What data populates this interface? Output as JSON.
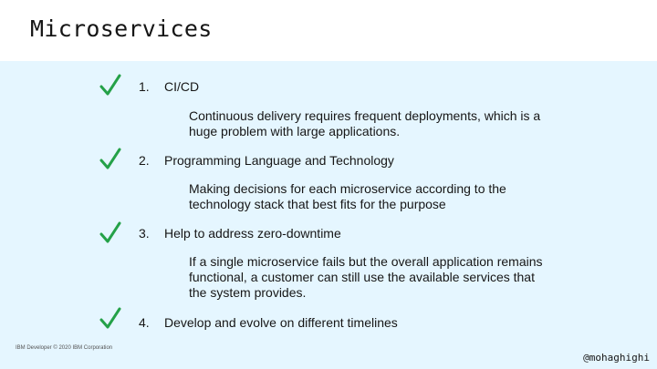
{
  "slide": {
    "title": "Microservices",
    "footer_left": "IBM Developer © 2020 IBM Corporation",
    "footer_right": "@mohaghighi",
    "accent_color": "#24a148",
    "background_color": "#e5f6ff"
  },
  "items": [
    {
      "icon": "checkmark-icon",
      "number": "1.",
      "label": "CI/CD",
      "description": "Continuous delivery requires frequent deployments, which is a huge problem with large applications."
    },
    {
      "icon": "checkmark-icon",
      "number": "2.",
      "label": "Programming Language and Technology",
      "description": "Making decisions for each microservice according to the technology stack that best fits for the purpose"
    },
    {
      "icon": "checkmark-icon",
      "number": "3.",
      "label": "Help to address zero-downtime",
      "description": "If a single microservice fails but the overall application remains functional, a customer can still use the available services that the system provides."
    },
    {
      "icon": "checkmark-icon",
      "number": "4.",
      "label": "Develop and evolve on different timelines",
      "description": ""
    }
  ]
}
